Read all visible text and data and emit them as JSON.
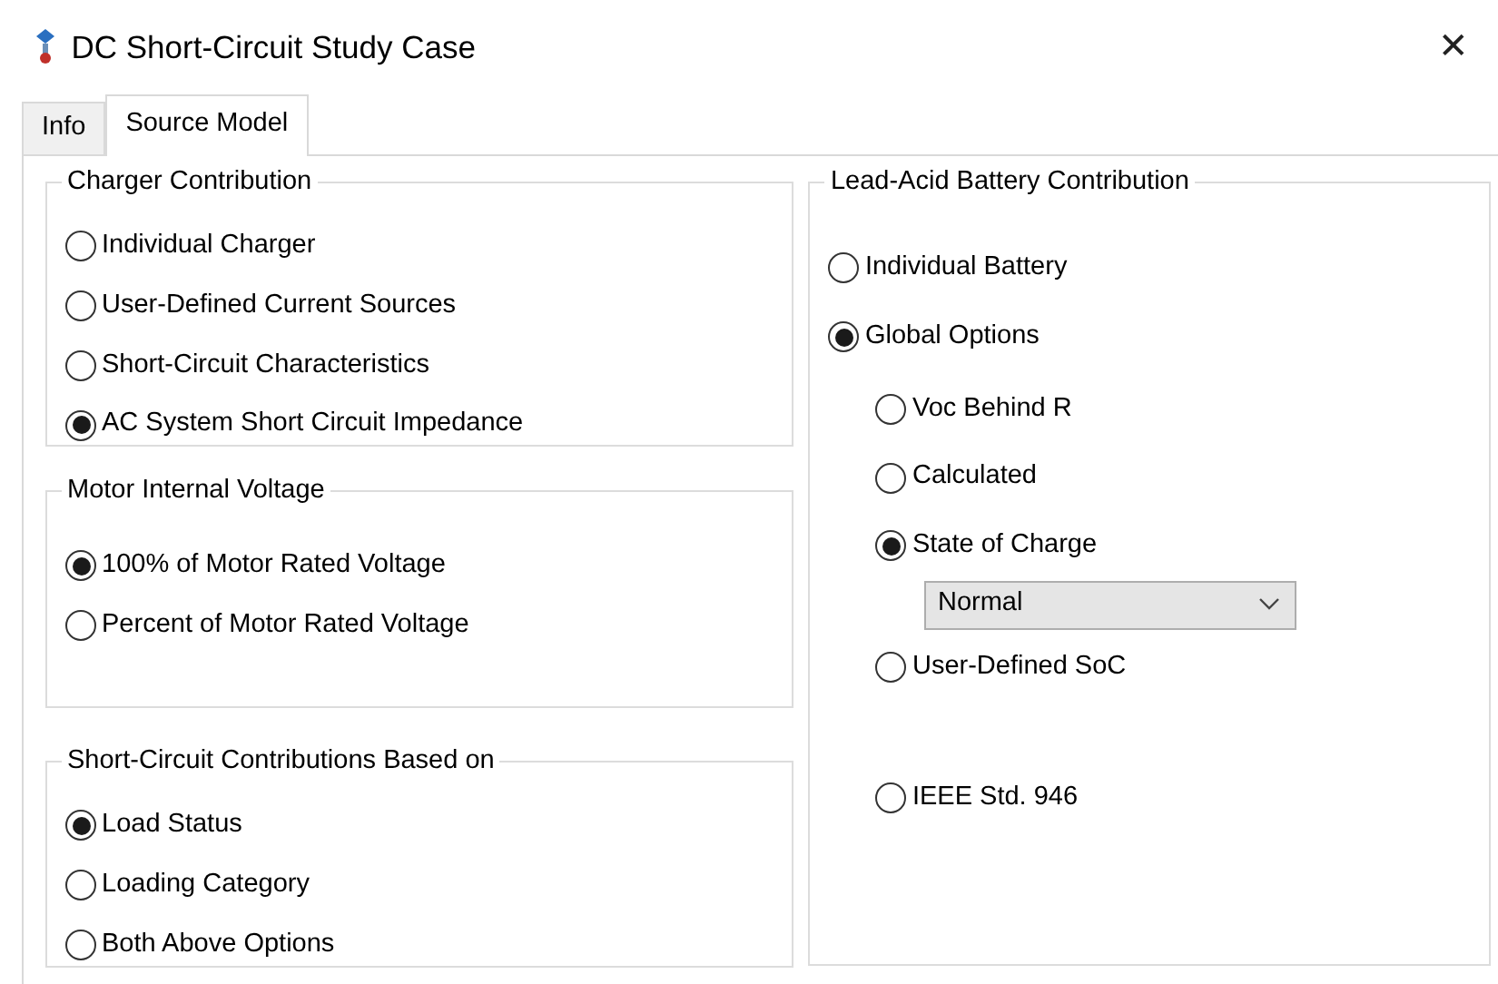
{
  "window": {
    "title": "DC Short-Circuit Study Case",
    "close_button": "✕"
  },
  "tabs": [
    {
      "label": "Info",
      "selected": false
    },
    {
      "label": "Source Model",
      "selected": true
    }
  ],
  "left_groups": [
    {
      "title": "Charger Contribution",
      "options": [
        {
          "label": "Individual Charger",
          "selected": false
        },
        {
          "label": "User-Defined Current Sources",
          "selected": false
        },
        {
          "label": "Short-Circuit Characteristics",
          "selected": false
        },
        {
          "label": "AC System Short Circuit Impedance",
          "selected": true
        }
      ]
    },
    {
      "title": "Motor Internal Voltage",
      "options": [
        {
          "label": "100% of Motor Rated Voltage",
          "selected": true
        },
        {
          "label": "Percent of Motor Rated Voltage",
          "selected": false
        }
      ]
    },
    {
      "title": "Short-Circuit Contributions Based on",
      "options": [
        {
          "label": "Load Status",
          "selected": true
        },
        {
          "label": "Loading Category",
          "selected": false
        },
        {
          "label": "Both Above Options",
          "selected": false
        }
      ]
    }
  ],
  "right_group": {
    "title": "Lead-Acid Battery Contribution",
    "options": [
      {
        "label": "Individual Battery",
        "selected": false
      },
      {
        "label": "Global Options",
        "selected": true,
        "children": [
          {
            "label": "Voc Behind R",
            "selected": false
          },
          {
            "label": "Calculated",
            "selected": false
          },
          {
            "label": "State of Charge",
            "selected": true,
            "dropdown": {
              "value": "Normal"
            }
          },
          {
            "label": "User-Defined SoC",
            "selected": false
          },
          {
            "label": "IEEE Std. 946",
            "selected": false
          }
        ]
      }
    ]
  }
}
